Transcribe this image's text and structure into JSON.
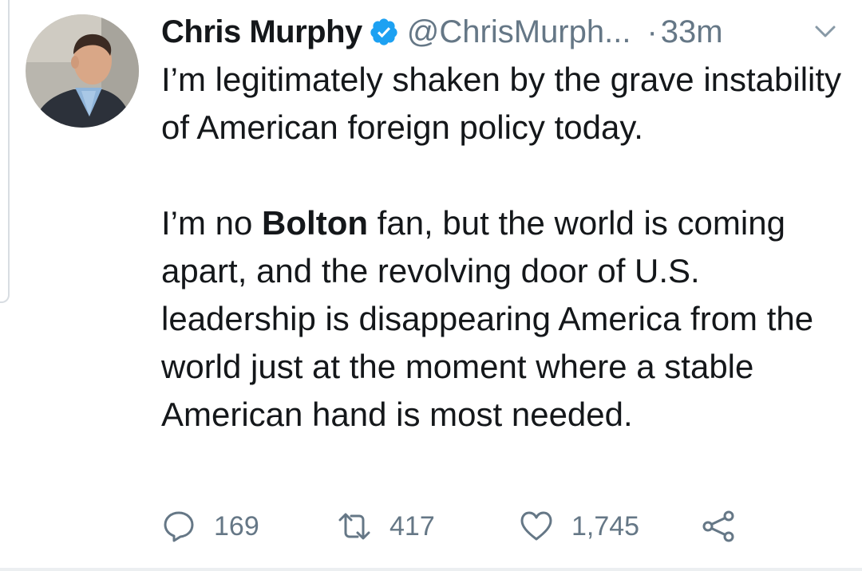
{
  "tweet": {
    "author": {
      "display_name": "Chris Murphy",
      "handle": "@ChrisMurph...",
      "verified": true
    },
    "separator": "·",
    "time": "33m",
    "body": {
      "paragraph1": "I’m legitimately shaken by the grave instability of American foreign policy today.",
      "paragraph2_before": "I’m no ",
      "paragraph2_bold": "Bolton",
      "paragraph2_after": " fan, but the world is coming apart, and the revolving door of U.S. leadership is disappearing America from the world just at the moment where a stable American hand is most needed."
    },
    "actions": {
      "replies": "169",
      "retweets": "417",
      "likes": "1,745"
    }
  },
  "colors": {
    "text": "#14171a",
    "secondary": "#657786",
    "verified": "#1da1f2"
  },
  "icons": [
    "verified-badge-icon",
    "chevron-down-icon",
    "reply-icon",
    "retweet-icon",
    "like-icon",
    "share-icon"
  ]
}
